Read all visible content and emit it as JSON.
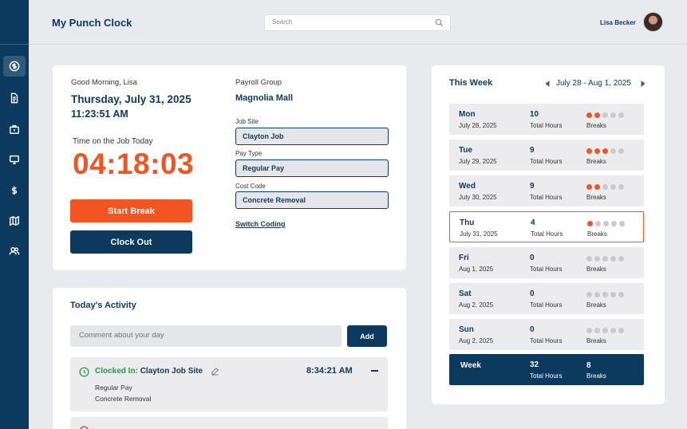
{
  "app": {
    "title": "My Punch Clock"
  },
  "search": {
    "placeholder": "Search"
  },
  "user": {
    "name": "Lisa Becker"
  },
  "sidebar": {
    "items": [
      {
        "icon": "dollar-clock-icon",
        "active": true
      },
      {
        "icon": "document-icon"
      },
      {
        "icon": "briefcase-icon"
      },
      {
        "icon": "monitor-icon"
      },
      {
        "icon": "dollar-icon"
      },
      {
        "icon": "map-icon"
      },
      {
        "icon": "users-icon"
      }
    ]
  },
  "clock": {
    "greeting": "Good Morning, Lisa",
    "date": "Thursday, July 31, 2025",
    "time": "11:23:51 AM",
    "job_time_label": "Time on the Job Today",
    "job_time": "04:18:03",
    "start_break": "Start Break",
    "clock_out": "Clock Out",
    "payroll_label": "Payroll Group",
    "payroll_value": "Magnolia Mall",
    "job_site_label": "Job Site",
    "job_site_value": "Clayton Job",
    "pay_type_label": "Pay Type",
    "pay_type_value": "Regular Pay",
    "cost_code_label": "Cost Code",
    "cost_code_value": "Concrete Removal",
    "switch_coding": "Switch Coding"
  },
  "activity": {
    "title": "Today's Activity",
    "comment_placeholder": "Comment about your day",
    "add_label": "Add",
    "items": [
      {
        "prefix": "Clocked In:",
        "site": "Clayton Job Site",
        "time": "8:34:21 AM",
        "line1": "Regular Pay",
        "line2": "Concrete Removal"
      }
    ]
  },
  "week": {
    "title": "This Week",
    "range": "July 28 - Aug 1, 2025",
    "total_hours_label": "Total Hours",
    "breaks_label": "Breaks",
    "days": [
      {
        "name": "Mon",
        "date": "July 28, 2025",
        "hours": "10",
        "breaks": 2,
        "today": false
      },
      {
        "name": "Tue",
        "date": "July 29, 2025",
        "hours": "9",
        "breaks": 3,
        "today": false
      },
      {
        "name": "Wed",
        "date": "July 30, 2025",
        "hours": "9",
        "breaks": 2,
        "today": false
      },
      {
        "name": "Thu",
        "date": "July 31, 2025",
        "hours": "4",
        "breaks": 1,
        "today": true
      },
      {
        "name": "Fri",
        "date": "Aug 1, 2025",
        "hours": "0",
        "breaks": 0,
        "today": false
      },
      {
        "name": "Sat",
        "date": "Aug 2, 2025",
        "hours": "0",
        "breaks": 0,
        "today": false
      },
      {
        "name": "Sun",
        "date": "Aug 2, 2025",
        "hours": "0",
        "breaks": 0,
        "today": false
      }
    ],
    "total": {
      "name": "Week",
      "hours": "32",
      "breaks": "8"
    }
  },
  "colors": {
    "navy": "#0b3a5e",
    "orange": "#f25522",
    "green": "#1e9e4a",
    "red": "#d93025"
  }
}
